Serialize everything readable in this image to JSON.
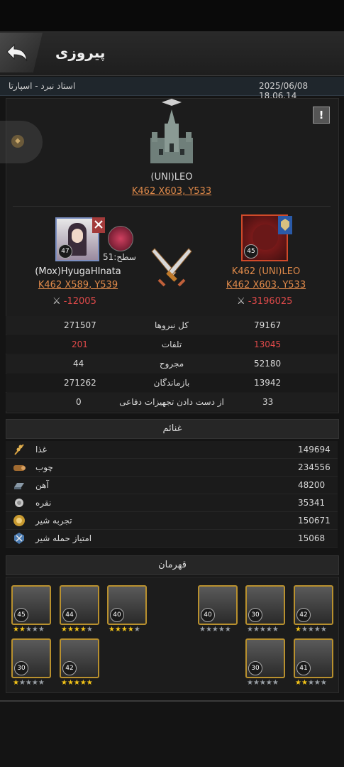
{
  "header": {
    "title": "پیروزی"
  },
  "subbar": {
    "date": "2025/06/08 18.06.14",
    "location": "استاد نبرد - اسپارتا"
  },
  "target": {
    "name": "(UNI)LEO",
    "coords": "K462 X603, Y533"
  },
  "defender": {
    "name": "(Mox)HyugaHInata",
    "coords": "K462 X589, Y539",
    "level": "47",
    "loss_power": "-12005",
    "tier_label": "سطح:51"
  },
  "attacker": {
    "name": "K462 (UNI)LEO",
    "coords": "K462 X603, Y533",
    "level": "45",
    "loss_power": "-3196025"
  },
  "stats": [
    {
      "label": "کل نیروها",
      "left": "271507",
      "right": "79167",
      "highlight": false
    },
    {
      "label": "تلفات",
      "left": "201",
      "right": "13045",
      "highlight": true
    },
    {
      "label": "مجروح",
      "left": "44",
      "right": "52180",
      "highlight": false
    },
    {
      "label": "بازماندگان",
      "left": "271262",
      "right": "13942",
      "highlight": false
    },
    {
      "label": "از دست دادن تجهیزات دفاعی",
      "left": "0",
      "right": "33",
      "highlight": false
    }
  ],
  "loot": {
    "title": "غنائم",
    "items": [
      {
        "name": "غذا",
        "value": "149694",
        "icon": "wheat-icon"
      },
      {
        "name": "چوب",
        "value": "234556",
        "icon": "wood-icon"
      },
      {
        "name": "آهن",
        "value": "48200",
        "icon": "iron-icon"
      },
      {
        "name": "نقره",
        "value": "35341",
        "icon": "silver-icon"
      },
      {
        "name": "تجربه شیر",
        "value": "150671",
        "icon": "lion-xp-icon"
      },
      {
        "name": "امتیاز حمله شیر",
        "value": "15068",
        "icon": "lion-attack-icon"
      }
    ]
  },
  "heroes": {
    "title": "قهرمان",
    "left": [
      {
        "level": "45",
        "stars": 2
      },
      {
        "level": "44",
        "stars": 4
      },
      {
        "level": "40",
        "stars": 4
      },
      {
        "level": "30",
        "stars": 1
      },
      {
        "level": "42",
        "stars": 5
      }
    ],
    "right": [
      {
        "level": "40",
        "stars": 0
      },
      {
        "level": "30",
        "stars": 0
      },
      {
        "level": "42",
        "stars": 1
      },
      {
        "level": "30",
        "stars": 0
      },
      {
        "level": "41",
        "stars": 2
      }
    ]
  },
  "colors": {
    "accent": "#e08a4a",
    "loss": "#e04a4a",
    "gold": "#b8902e"
  }
}
